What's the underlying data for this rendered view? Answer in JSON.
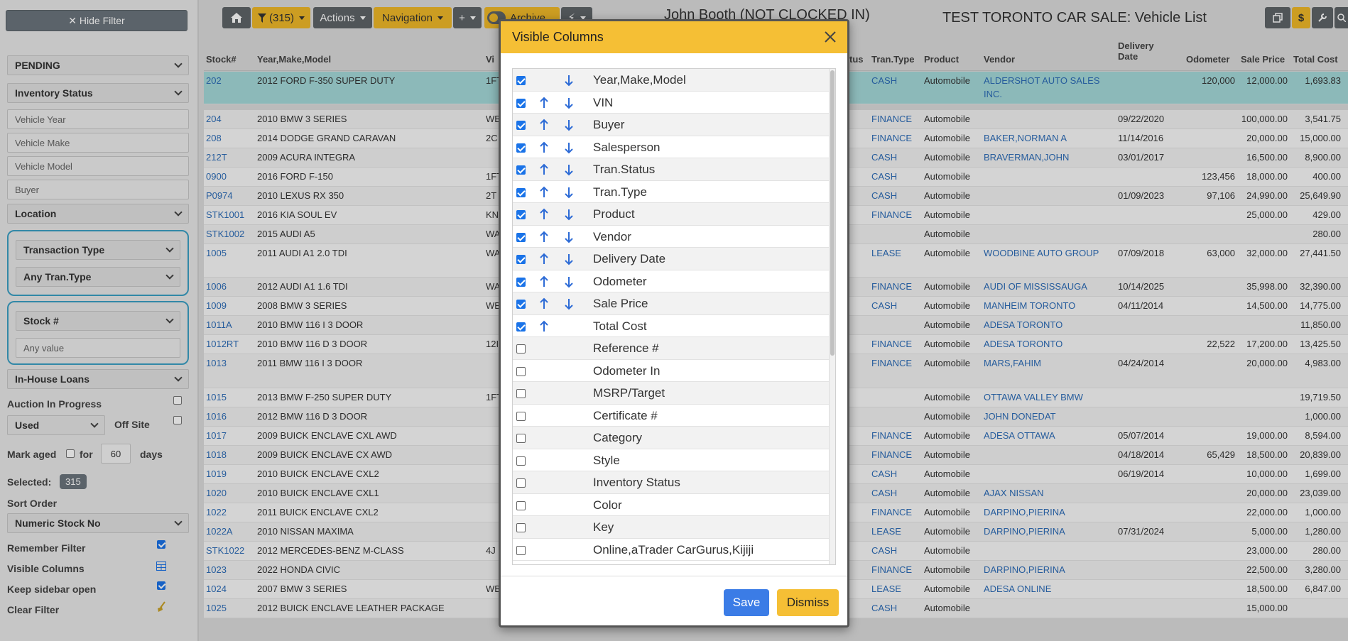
{
  "sidebar": {
    "hide_filter": "✕ Hide Filter",
    "pending": "PENDING",
    "inventory_status": "Inventory Status",
    "vehicle_year": "Vehicle Year",
    "vehicle_make": "Vehicle Make",
    "vehicle_model": "Vehicle Model",
    "buyer": "Buyer",
    "location": "Location",
    "transaction_type": "Transaction Type",
    "any_tran_type": "Any Tran.Type",
    "stock_no": "Stock #",
    "any_value": "Any value",
    "in_house_loans": "In-House Loans",
    "auction_in_progress": "Auction In Progress",
    "used": "Used",
    "off_site": "Off Site",
    "mark_aged": "Mark aged",
    "for": "for",
    "days_value": "60",
    "days": "days",
    "selected_label": "Selected:",
    "selected_count": "315",
    "sort_order": "Sort Order",
    "sort_value": "Numeric Stock No",
    "remember_filter": "Remember Filter",
    "visible_columns": "Visible Columns",
    "keep_sidebar_open": "Keep sidebar open",
    "clear_filter": "Clear Filter"
  },
  "topbar": {
    "filter_count": "(315)",
    "actions": "Actions",
    "navigation": "Navigation",
    "plus": "+",
    "archive": "Archive",
    "user": "John Booth (NOT CLOCKED IN)",
    "page_title": "TEST TORONTO CAR SALE: Vehicle List"
  },
  "table": {
    "headers": {
      "stock": "Stock#",
      "ymm": "Year,Make,Model",
      "vin_partial": "Vi",
      "status_partial": "tus",
      "tran_type": "Tran.Type",
      "product": "Product",
      "vendor": "Vendor",
      "delivery_date_1": "Delivery",
      "delivery_date_2": "Date",
      "odometer": "Odometer",
      "sale_price": "Sale Price",
      "total_cost": "Total Cost"
    },
    "rows": [
      {
        "stock": "202",
        "ymm": "2012 FORD F-350 SUPER DUTY",
        "vin": "1FT",
        "tran": "CASH",
        "product": "Automobile",
        "vendor": "ALDERSHOT AUTO SALES",
        "vendor2": "INC.",
        "date": "",
        "odo": "120,000",
        "price": "12,000.00",
        "cost": "1,693.83"
      },
      {
        "stock": "204",
        "ymm": "2010 BMW 3 SERIES",
        "vin": "WB",
        "tran": "FINANCE",
        "product": "Automobile",
        "vendor": "",
        "vendor2": "",
        "date": "09/22/2020",
        "odo": "",
        "price": "100,000.00",
        "cost": "3,541.75"
      },
      {
        "stock": "208",
        "ymm": "2014 DODGE GRAND CARAVAN",
        "vin": "2C",
        "tran": "FINANCE",
        "product": "Automobile",
        "vendor": "BAKER,NORMAN A",
        "vendor2": "",
        "date": "11/14/2016",
        "odo": "",
        "price": "20,000.00",
        "cost": "15,000.00"
      },
      {
        "stock": "212T",
        "ymm": "2009 ACURA INTEGRA",
        "vin": "",
        "tran": "CASH",
        "product": "Automobile",
        "vendor": "BRAVERMAN,JOHN",
        "vendor2": "",
        "date": "03/01/2017",
        "odo": "",
        "price": "16,500.00",
        "cost": "8,900.00"
      },
      {
        "stock": "0900",
        "ymm": "2016 FORD F-150",
        "vin": "1FT",
        "tran": "CASH",
        "product": "Automobile",
        "vendor": "",
        "vendor2": "",
        "date": "",
        "odo": "123,456",
        "price": "18,000.00",
        "cost": "400.00"
      },
      {
        "stock": "P0974",
        "ymm": "2010 LEXUS RX 350",
        "vin": "2T",
        "tran": "CASH",
        "product": "Automobile",
        "vendor": "",
        "vendor2": "",
        "date": "01/09/2023",
        "odo": "97,106",
        "price": "24,990.00",
        "cost": "25,649.90"
      },
      {
        "stock": "STK1001",
        "ymm": "2016 KIA SOUL EV",
        "vin": "KN",
        "tran": "FINANCE",
        "product": "Automobile",
        "vendor": "",
        "vendor2": "",
        "date": "",
        "odo": "",
        "price": "25,000.00",
        "cost": "429.00"
      },
      {
        "stock": "STK1002",
        "ymm": "2015 AUDI A5",
        "vin": "WA",
        "tran": "",
        "product": "Automobile",
        "vendor": "",
        "vendor2": "",
        "date": "",
        "odo": "",
        "price": "",
        "cost": "280.00"
      },
      {
        "stock": "1005",
        "ymm": "2011 AUDI A1 2.0 TDI",
        "vin": "WA",
        "tran": "LEASE",
        "product": "Automobile",
        "vendor": "WOODBINE AUTO GROUP",
        "vendor2": "",
        "date": "07/09/2018",
        "odo": "63,000",
        "price": "32,000.00",
        "cost": "27,441.50"
      },
      {
        "stock": "1006",
        "ymm": "2012 AUDI A1 1.6 TDI",
        "vin": "WA",
        "tran": "FINANCE",
        "product": "Automobile",
        "vendor": "AUDI OF MISSISSAUGA",
        "vendor2": "",
        "date": "10/14/2025",
        "odo": "",
        "price": "35,998.00",
        "cost": "32,390.00"
      },
      {
        "stock": "1009",
        "ymm": "2008 BMW 3 SERIES",
        "vin": "WB",
        "tran": "CASH",
        "product": "Automobile",
        "vendor": "MANHEIM TORONTO",
        "vendor2": "",
        "date": "04/11/2014",
        "odo": "",
        "price": "14,500.00",
        "cost": "14,775.00"
      },
      {
        "stock": "1011A",
        "ymm": "2010 BMW 116 I 3 DOOR",
        "vin": "",
        "tran": "",
        "product": "Automobile",
        "vendor": "ADESA TORONTO",
        "vendor2": "",
        "date": "",
        "odo": "",
        "price": "",
        "cost": "11,850.00"
      },
      {
        "stock": "1012RT",
        "ymm": "2010 BMW 116 D 3 DOOR",
        "vin": "12I",
        "tran": "FINANCE",
        "product": "Automobile",
        "vendor": "ADESA TORONTO",
        "vendor2": "",
        "date": "",
        "odo": "22,522",
        "price": "17,200.00",
        "cost": "13,425.50"
      },
      {
        "stock": "1013",
        "ymm": "2011 BMW 116 I 3 DOOR",
        "vin": "",
        "tran": "FINANCE",
        "product": "Automobile",
        "vendor": "MARS,FAHIM",
        "vendor2": "",
        "date": "04/24/2014",
        "odo": "",
        "price": "20,000.00",
        "cost": "4,983.00"
      },
      {
        "stock": "1015",
        "ymm": "2013 BMW F-250 SUPER DUTY",
        "vin": "1FT",
        "tran": "",
        "product": "Automobile",
        "vendor": "OTTAWA VALLEY BMW",
        "vendor2": "",
        "date": "",
        "odo": "",
        "price": "",
        "cost": "19,719.50"
      },
      {
        "stock": "1016",
        "ymm": "2012 BMW 116 D 3 DOOR",
        "vin": "",
        "tran": "",
        "product": "Automobile",
        "vendor": "JOHN DONEDAT",
        "vendor2": "",
        "date": "",
        "odo": "",
        "price": "",
        "cost": "1,000.00"
      },
      {
        "stock": "1017",
        "ymm": "2009 BUICK ENCLAVE CXL AWD",
        "vin": "",
        "tran": "FINANCE",
        "product": "Automobile",
        "vendor": "ADESA OTTAWA",
        "vendor2": "",
        "date": "05/07/2014",
        "odo": "",
        "price": "19,000.00",
        "cost": "8,594.00"
      },
      {
        "stock": "1018",
        "ymm": "2009 BUICK ENCLAVE CX AWD",
        "vin": "",
        "tran": "FINANCE",
        "product": "Automobile",
        "vendor": "",
        "vendor2": "",
        "date": "04/18/2014",
        "odo": "65,429",
        "price": "18,500.00",
        "cost": "20,839.00"
      },
      {
        "stock": "1019",
        "ymm": "2010 BUICK ENCLAVE CXL2",
        "vin": "",
        "tran": "CASH",
        "product": "Automobile",
        "vendor": "",
        "vendor2": "",
        "date": "06/19/2014",
        "odo": "",
        "price": "10,000.00",
        "cost": "1,699.00"
      },
      {
        "stock": "1020",
        "ymm": "2010 BUICK ENCLAVE CXL1",
        "vin": "",
        "tran": "CASH",
        "product": "Automobile",
        "vendor": "AJAX NISSAN",
        "vendor2": "",
        "date": "",
        "odo": "",
        "price": "20,000.00",
        "cost": "23,039.00"
      },
      {
        "stock": "1022",
        "ymm": "2011 BUICK ENCLAVE CXL2",
        "vin": "",
        "tran": "FINANCE",
        "product": "Automobile",
        "vendor": "DARPINO,PIERINA",
        "vendor2": "",
        "date": "",
        "odo": "",
        "price": "22,000.00",
        "cost": "1,000.00"
      },
      {
        "stock": "1022A",
        "ymm": "2010 NISSAN MAXIMA",
        "vin": "",
        "tran": "LEASE",
        "product": "Automobile",
        "vendor": "DARPINO,PIERINA",
        "vendor2": "",
        "date": "07/31/2024",
        "odo": "",
        "price": "5,000.00",
        "cost": "1,280.00"
      },
      {
        "stock": "STK1022",
        "ymm": "2012 MERCEDES-BENZ M-CLASS",
        "vin": "4J",
        "tran": "CASH",
        "product": "Automobile",
        "vendor": "",
        "vendor2": "",
        "date": "",
        "odo": "",
        "price": "23,000.00",
        "cost": "280.00"
      },
      {
        "stock": "1023",
        "ymm": "2022 HONDA CIVIC",
        "vin": "",
        "tran": "FINANCE",
        "product": "Automobile",
        "vendor": "DARPINO,PIERINA",
        "vendor2": "",
        "date": "",
        "odo": "",
        "price": "22,500.00",
        "cost": "3,280.00"
      },
      {
        "stock": "1024",
        "ymm": "2007 BMW 3 SERIES",
        "vin": "WB",
        "tran": "LEASE",
        "product": "Automobile",
        "vendor": "ADESA ONLINE",
        "vendor2": "",
        "date": "",
        "odo": "",
        "price": "18,500.00",
        "cost": "6,847.00"
      },
      {
        "stock": "1025",
        "ymm": "2012 BUICK ENCLAVE LEATHER PACKAGE",
        "vin": "",
        "tran": "CASH",
        "product": "Automobile",
        "vendor": "",
        "vendor2": "",
        "date": "",
        "odo": "",
        "price": "15,000.00",
        "cost": ""
      }
    ]
  },
  "modal": {
    "title": "Visible Columns",
    "save": "Save",
    "dismiss": "Dismiss",
    "columns": [
      {
        "label": "Year,Make,Model",
        "checked": true,
        "up": false,
        "down": true
      },
      {
        "label": "VIN",
        "checked": true,
        "up": true,
        "down": true
      },
      {
        "label": "Buyer",
        "checked": true,
        "up": true,
        "down": true
      },
      {
        "label": "Salesperson",
        "checked": true,
        "up": true,
        "down": true
      },
      {
        "label": "Tran.Status",
        "checked": true,
        "up": true,
        "down": true
      },
      {
        "label": "Tran.Type",
        "checked": true,
        "up": true,
        "down": true
      },
      {
        "label": "Product",
        "checked": true,
        "up": true,
        "down": true
      },
      {
        "label": "Vendor",
        "checked": true,
        "up": true,
        "down": true
      },
      {
        "label": "Delivery Date",
        "checked": true,
        "up": true,
        "down": true
      },
      {
        "label": "Odometer",
        "checked": true,
        "up": true,
        "down": true
      },
      {
        "label": "Sale Price",
        "checked": true,
        "up": true,
        "down": true
      },
      {
        "label": "Total Cost",
        "checked": true,
        "up": true,
        "down": false
      },
      {
        "label": "Reference #",
        "checked": false,
        "up": false,
        "down": false
      },
      {
        "label": "Odometer In",
        "checked": false,
        "up": false,
        "down": false
      },
      {
        "label": "MSRP/Target",
        "checked": false,
        "up": false,
        "down": false
      },
      {
        "label": "Certificate #",
        "checked": false,
        "up": false,
        "down": false
      },
      {
        "label": "Category",
        "checked": false,
        "up": false,
        "down": false
      },
      {
        "label": "Style",
        "checked": false,
        "up": false,
        "down": false
      },
      {
        "label": "Inventory Status",
        "checked": false,
        "up": false,
        "down": false
      },
      {
        "label": "Color",
        "checked": false,
        "up": false,
        "down": false
      },
      {
        "label": "Key",
        "checked": false,
        "up": false,
        "down": false
      },
      {
        "label": "Online,aTrader CarGurus,Kijiji",
        "checked": false,
        "up": false,
        "down": false
      }
    ]
  },
  "colors": {
    "accent_yellow": "#f5bf35",
    "link_blue": "#2d6db8",
    "save_blue": "#3b7ce6",
    "highlight_row": "#a5dada"
  }
}
